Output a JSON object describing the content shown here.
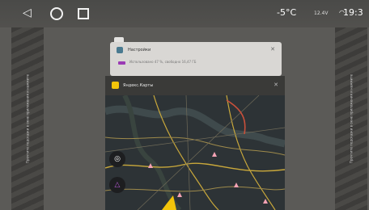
{
  "statusbar": {
    "nav": {
      "back_icon": "back-triangle-icon",
      "home_icon": "home-circle-icon",
      "recents_icon": "recents-square-icon"
    },
    "temperature": "-5°C",
    "battery_text": "12.4V",
    "time": "19:3"
  },
  "side_panels": {
    "left_text": "Прочтите подсказки в окне приложения и нажмите",
    "right_text": "Прочтите подсказки в окне приложения и нажмите"
  },
  "recent_cards": [
    {
      "app": "Настройки",
      "notification": "Использовано 47 %, свободно 16,47 ГБ",
      "icon": "settings-app-icon",
      "close_icon": "close-icon"
    },
    {
      "app": "Яндекс.Карты",
      "icon": "yandex-maps-app-icon",
      "close_icon": "close-icon",
      "map_buttons": [
        "chat-icon",
        "alice-icon"
      ]
    }
  ],
  "colors": {
    "statusbar": "#4f4e4b",
    "maps_accent": "#f2c40a",
    "alice_purple": "#b85bd6",
    "map_bg": "#2b3134"
  }
}
